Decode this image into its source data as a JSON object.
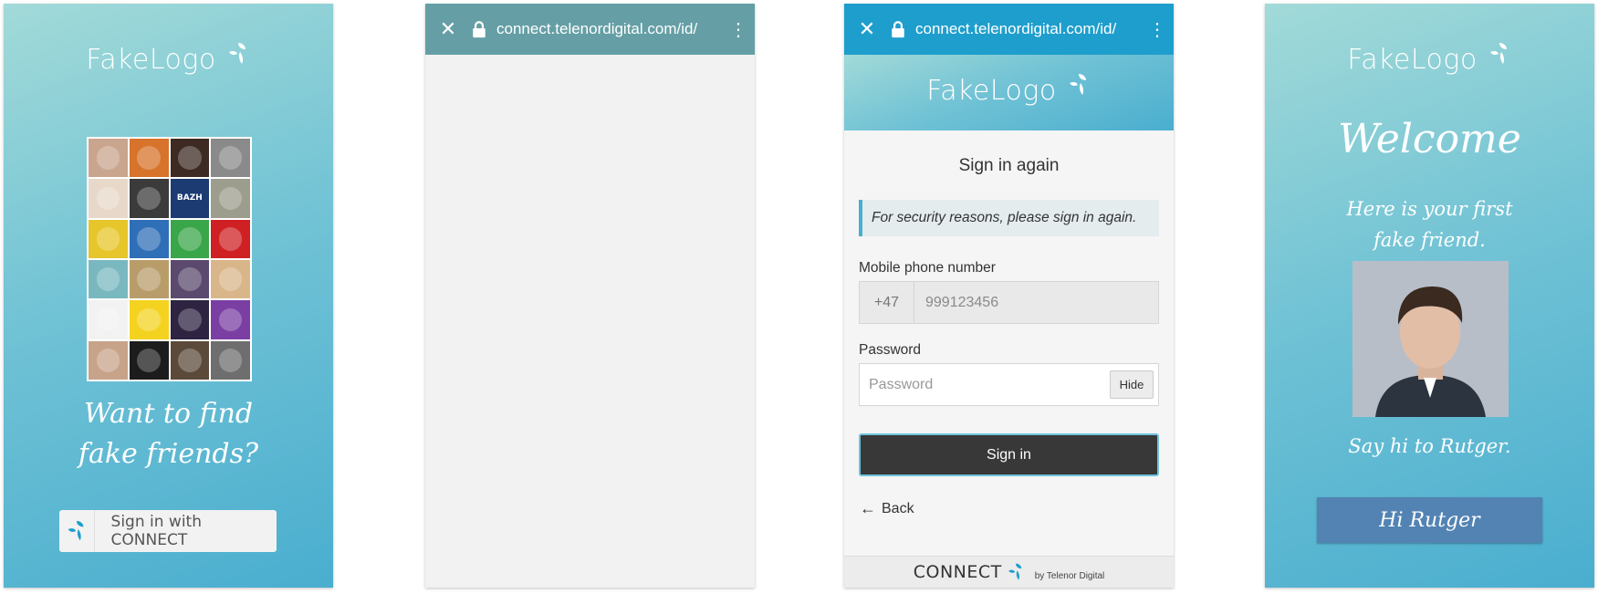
{
  "screen1": {
    "logo_text": "FakeLogo",
    "grid_tiles": [
      {
        "color": "#c9a58e"
      },
      {
        "color": "#d7732b"
      },
      {
        "color": "#3d2a22"
      },
      {
        "color": "#8a8a8a"
      },
      {
        "color": "#e7d8c9"
      },
      {
        "color": "#3b3b3b"
      },
      {
        "color": "#1b3b72",
        "text": "BAZH"
      },
      {
        "color": "#9d9d8e"
      },
      {
        "color": "#e6c62a"
      },
      {
        "color": "#2f6fb7"
      },
      {
        "color": "#3aa64a"
      },
      {
        "color": "#cf2124"
      },
      {
        "color": "#7ab8c0"
      },
      {
        "color": "#b89d6b"
      },
      {
        "color": "#5b4a6e"
      },
      {
        "color": "#d9b68a"
      },
      {
        "color": "#f2f2f2"
      },
      {
        "color": "#f4d320"
      },
      {
        "color": "#2e2340"
      },
      {
        "color": "#7b3fa3"
      },
      {
        "color": "#c7a38a"
      },
      {
        "color": "#1c1c1c"
      },
      {
        "color": "#5b4a3a"
      },
      {
        "color": "#6e6e6e"
      }
    ],
    "question_line1": "Want to find",
    "question_line2": "fake friends?",
    "connect_button": "Sign in with CONNECT"
  },
  "screen2": {
    "url": "connect.telenordigital.com/id/"
  },
  "screen3": {
    "url": "connect.telenordigital.com/id/",
    "logo_text": "FakeLogo",
    "title": "Sign in again",
    "notice": "For security reasons, please sign in again.",
    "phone_label": "Mobile phone number",
    "country_code": "+47",
    "phone_placeholder": "999123456",
    "password_label": "Password",
    "password_placeholder": "Password",
    "hide_button": "Hide",
    "signin_button": "Sign in",
    "back_link": "Back",
    "footer_brand": "CONNECT",
    "footer_by": "by Telenor Digital"
  },
  "screen4": {
    "logo_text": "FakeLogo",
    "welcome": "Welcome",
    "sub_line1": "Here is your first",
    "sub_line2": "fake friend.",
    "say_hi": "Say hi to Rutger.",
    "hi_button": "Hi Rutger"
  }
}
